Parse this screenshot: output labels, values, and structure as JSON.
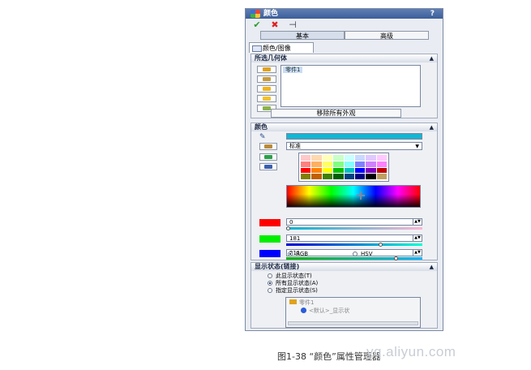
{
  "panel": {
    "title": "颜色",
    "help": "?",
    "toolbar": {
      "ok": "✔",
      "cancel": "✖",
      "pin": "⊣"
    },
    "modes": [
      "基本",
      "高级"
    ],
    "property_tab": "颜色/图像"
  },
  "geometry_group": {
    "header": "所选几何体",
    "selected_item": "零件1",
    "remove_button": "移除所有外观"
  },
  "color_group": {
    "header": "颜色",
    "dropdown_value": "标准",
    "swatch_color": "#14b6d3",
    "palette_colors": [
      "#ffc9c9",
      "#ffd9b0",
      "#ffffb8",
      "#c9ffc9",
      "#c9ffff",
      "#c9d9ff",
      "#e0c9ff",
      "#ffc9ff",
      "#ff8080",
      "#ffb060",
      "#ffff60",
      "#80ff80",
      "#80ffff",
      "#8080ff",
      "#d080ff",
      "#ff80ff",
      "#ff0000",
      "#ff8000",
      "#ffff00",
      "#00c000",
      "#00c0c0",
      "#0000ff",
      "#8000c0",
      "#c00000",
      "#808000",
      "#c06000",
      "#408000",
      "#006000",
      "#004080",
      "#000080",
      "#000000",
      "#c0a060"
    ],
    "channels": [
      {
        "name": "red",
        "swatch": "#ff0000",
        "value": "0",
        "fraction": 0.0
      },
      {
        "name": "green",
        "swatch": "#00ee00",
        "value": "181",
        "fraction": 0.71
      },
      {
        "name": "blue",
        "swatch": "#0000ff",
        "value": "211",
        "fraction": 0.83
      }
    ],
    "modes": [
      {
        "label": "RGB",
        "selected": true
      },
      {
        "label": "HSV",
        "selected": false
      }
    ]
  },
  "display_group": {
    "header": "显示状态(链接)",
    "options": [
      {
        "label": "此显示状态(T)",
        "selected": false
      },
      {
        "label": "所有显示状态(A)",
        "selected": true
      },
      {
        "label": "指定显示状态(S)",
        "selected": false
      }
    ],
    "list_items": [
      "零件1",
      "<默认>_显示状"
    ]
  },
  "caption": "图1-38 “颜色”属性管理器",
  "watermark": "yq.aliyun.com"
}
